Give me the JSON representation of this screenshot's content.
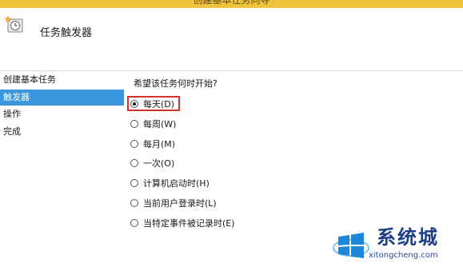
{
  "window": {
    "title": "创建基本任务向导"
  },
  "header": {
    "title": "任务触发器",
    "icon": "task-clock-icon"
  },
  "sidebar": {
    "items": [
      {
        "label": "创建基本任务",
        "selected": false
      },
      {
        "label": "触发器",
        "selected": true
      },
      {
        "label": "操作",
        "selected": false
      },
      {
        "label": "完成",
        "selected": false
      }
    ]
  },
  "content": {
    "question": "希望该任务何时开始?",
    "options": [
      {
        "label": "每天(D)",
        "checked": true
      },
      {
        "label": "每周(W)",
        "checked": false
      },
      {
        "label": "每月(M)",
        "checked": false
      },
      {
        "label": "一次(O)",
        "checked": false
      },
      {
        "label": "计算机启动时(H)",
        "checked": false
      },
      {
        "label": "当前用户登录时(L)",
        "checked": false
      },
      {
        "label": "当特定事件被记录时(E)",
        "checked": false
      }
    ]
  },
  "watermark": {
    "name": "系统城",
    "url": "xitongcheng.com",
    "logo": "windows-logo-icon"
  },
  "colors": {
    "title_bar": "#f0c33c",
    "selected_item": "#3a96dd",
    "highlight": "#d8302d",
    "watermark": "#1e3f86"
  }
}
